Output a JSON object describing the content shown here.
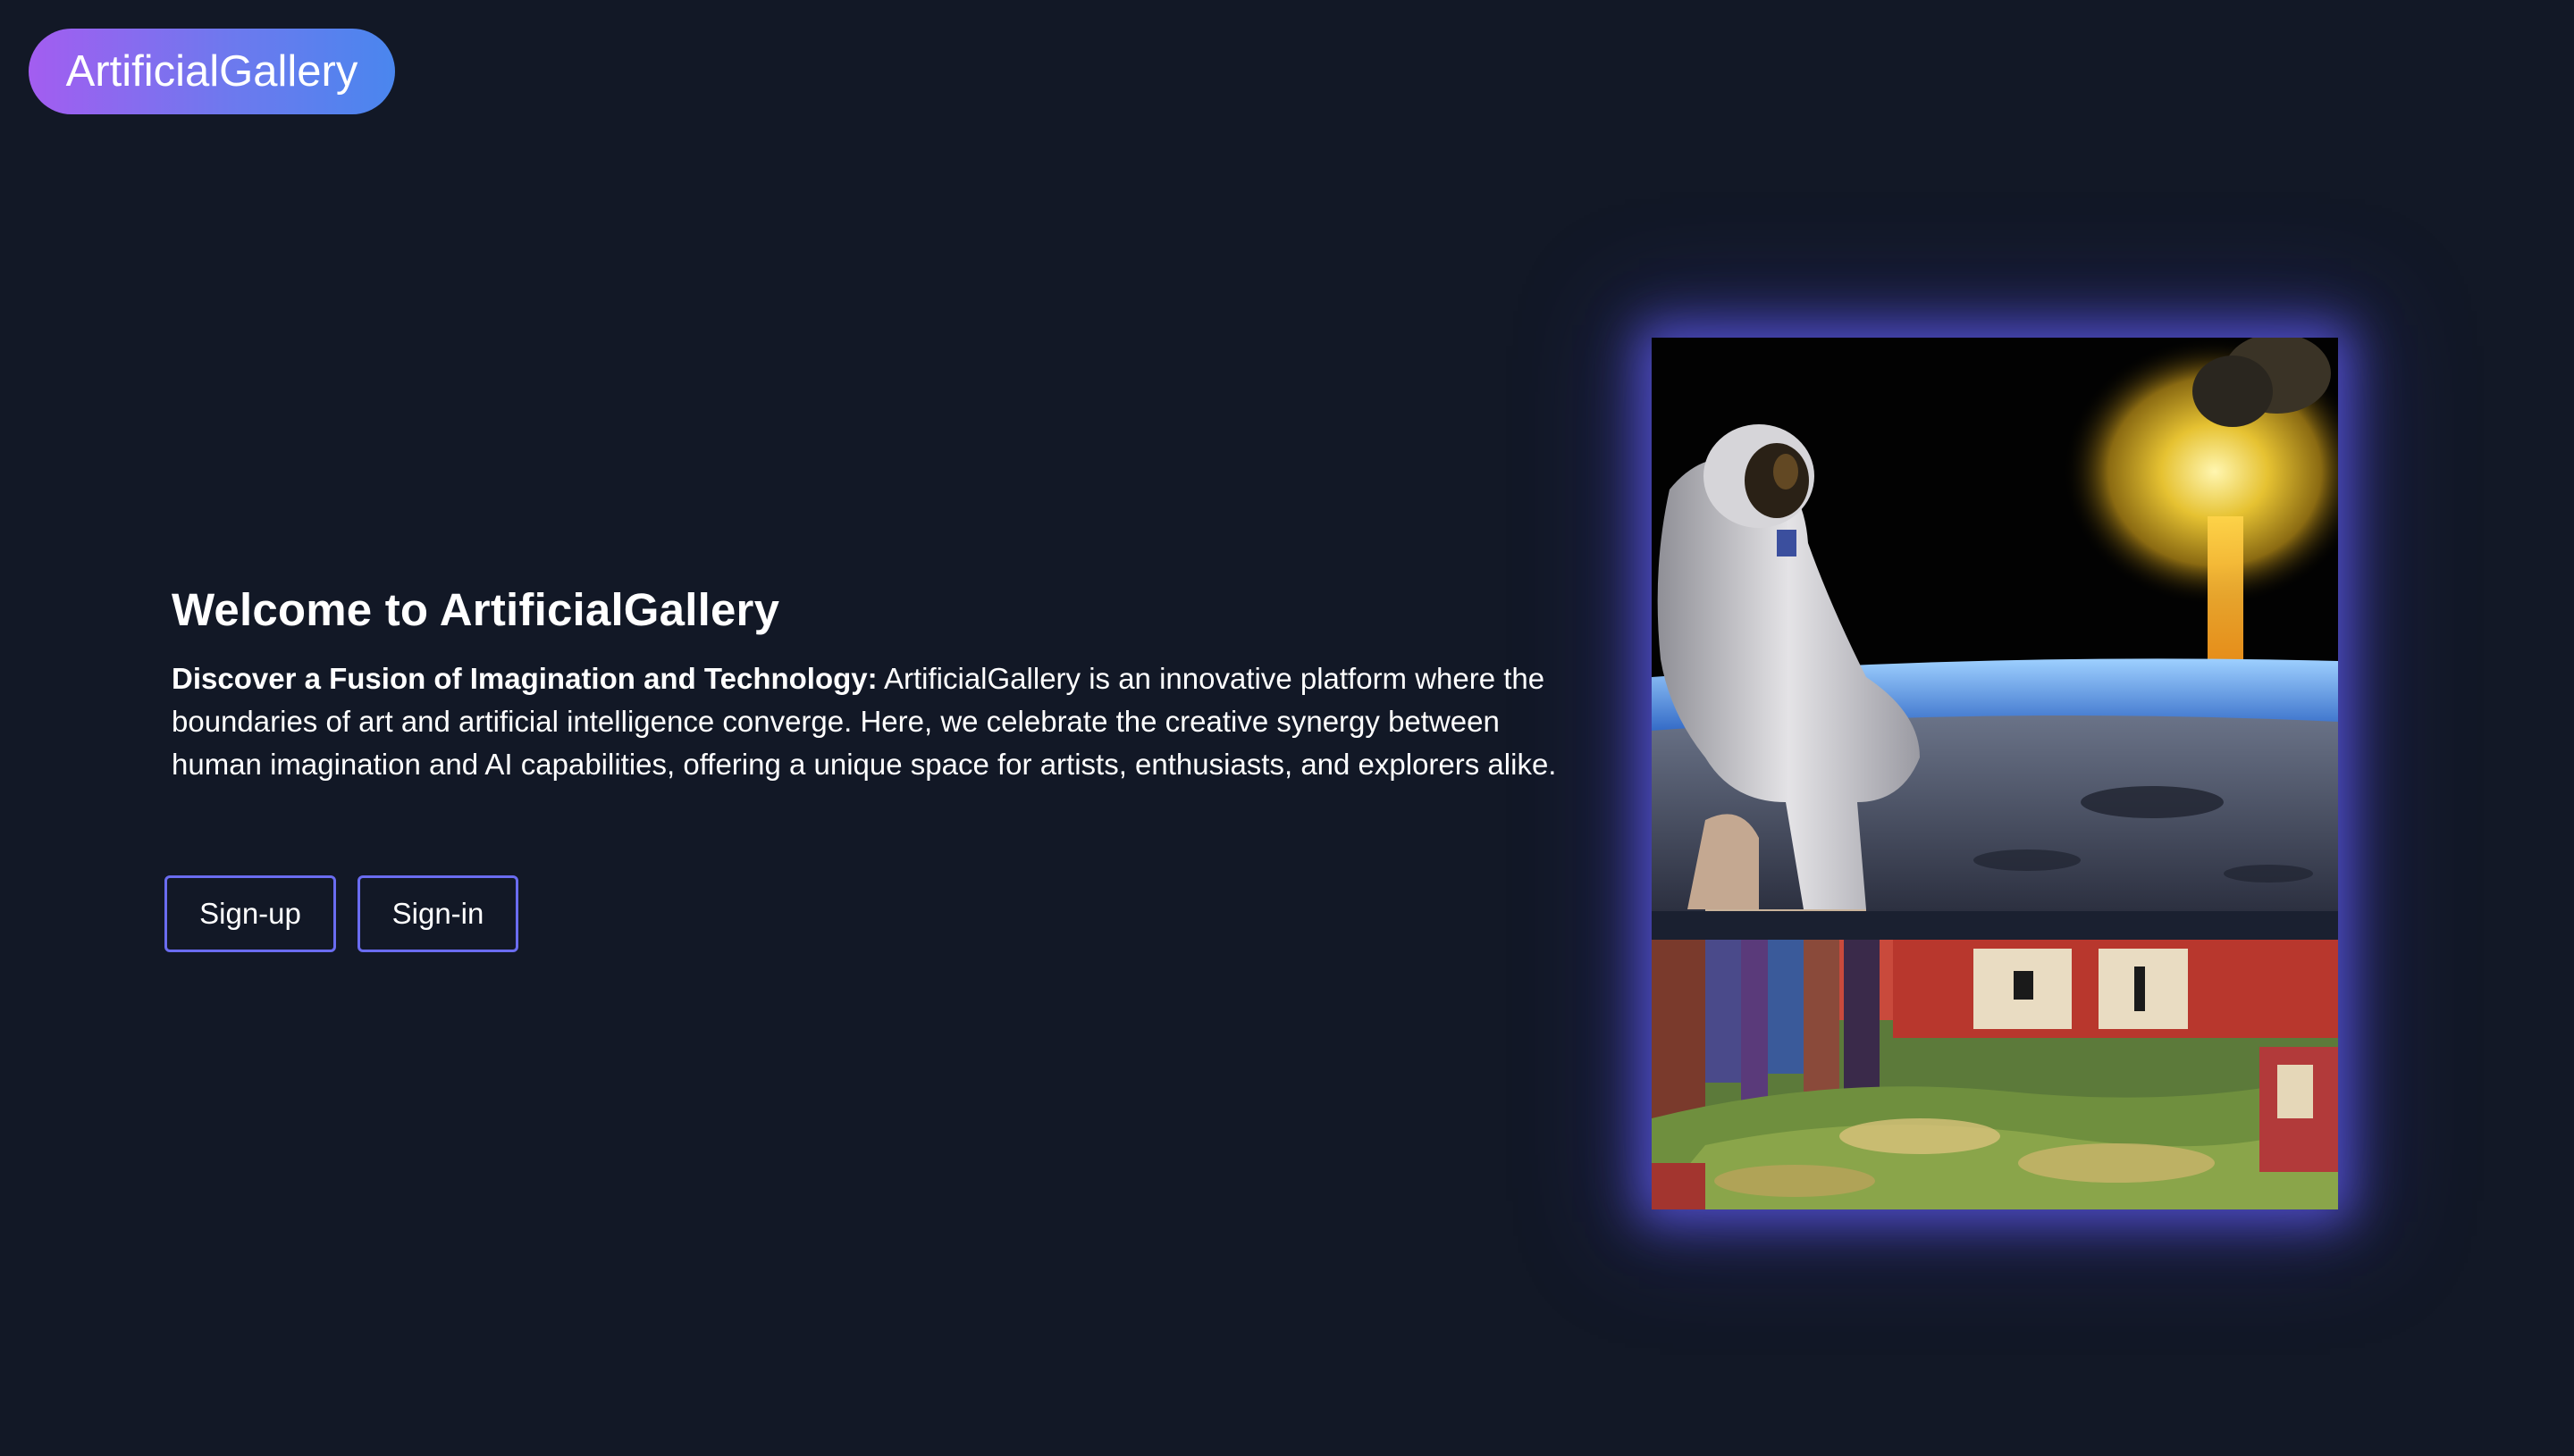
{
  "brand": {
    "name": "ArtificialGallery"
  },
  "hero": {
    "title": "Welcome to ArtificialGallery",
    "lead": "Discover a Fusion of Imagination and Technology:",
    "description": " ArtificialGallery is an innovative platform where the boundaries of art and artificial intelligence converge. Here, we celebrate the creative synergy between human imagination and AI capabilities, offering a unique space for artists, enthusiasts, and explorers alike."
  },
  "actions": {
    "signup_label": "Sign-up",
    "signin_label": "Sign-in"
  },
  "gallery": {
    "images": [
      {
        "name": "astronaut-on-moon-image"
      },
      {
        "name": "japanese-market-painting-image"
      }
    ]
  },
  "colors": {
    "background": "#121826",
    "button_border": "#6a6cf0",
    "brand_gradient_start": "#a35df0",
    "brand_gradient_end": "#4a86ee",
    "gallery_glow": "#605cf0"
  }
}
